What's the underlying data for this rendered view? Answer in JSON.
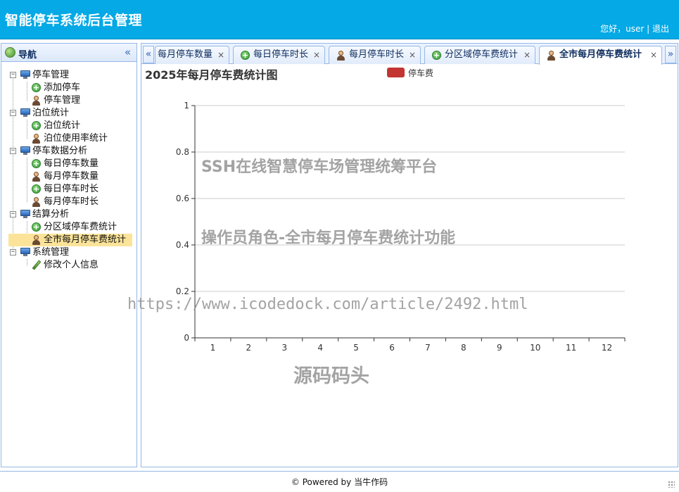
{
  "header": {
    "title": "智能停车系统后台管理",
    "greeting": "您好，user",
    "separator": "|",
    "logout": "退出"
  },
  "sidebar": {
    "title": "导航",
    "groups": [
      {
        "label": "停车管理",
        "items": [
          "添加停车",
          "停车管理"
        ]
      },
      {
        "label": "泊位统计",
        "items": [
          "泊位统计",
          "泊位使用率统计"
        ]
      },
      {
        "label": "停车数据分析",
        "items": [
          "每日停车数量",
          "每月停车数量",
          "每日停车时长",
          "每月停车时长"
        ]
      },
      {
        "label": "结算分析",
        "items": [
          "分区域停车费统计",
          "全市每月停车费统计"
        ]
      },
      {
        "label": "系统管理",
        "items": [
          "修改个人信息"
        ]
      }
    ]
  },
  "tabs": [
    {
      "label": "每月停车数量",
      "close": "×"
    },
    {
      "label": "每日停车时长",
      "close": "×"
    },
    {
      "label": "每月停车时长",
      "close": "×"
    },
    {
      "label": "分区域停车费统计",
      "close": "×"
    },
    {
      "label": "全市每月停车费统计",
      "close": "×"
    }
  ],
  "tab_scroll": {
    "left": "«",
    "right": "»"
  },
  "chart_data": {
    "type": "bar",
    "title": "2025年每月停车费统计图",
    "legend_position": "top-center",
    "series": [
      {
        "name": "停车费",
        "values": []
      }
    ],
    "categories": [
      "1",
      "2",
      "3",
      "4",
      "5",
      "6",
      "7",
      "8",
      "9",
      "10",
      "11",
      "12"
    ],
    "y_ticks": [
      "0",
      "0.2",
      "0.4",
      "0.6",
      "0.8",
      "1"
    ],
    "ylim": [
      0,
      1
    ],
    "grid": true,
    "colors": {
      "series": "#c23531",
      "grid": "#cccccc",
      "axis": "#333333"
    }
  },
  "watermarks": [
    "SSH在线智慧停车场管理统筹平台",
    "操作员角色-全市每月停车费统计功能",
    "https://www.icodedock.com/article/2492.html",
    "源码码头"
  ],
  "footer": {
    "text": "© Powered by 当牛作码"
  }
}
